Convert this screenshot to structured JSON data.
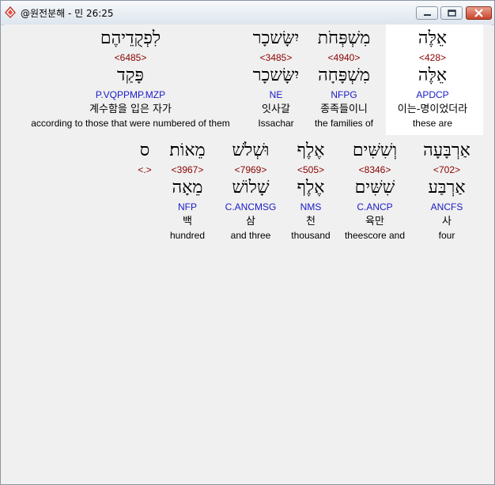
{
  "window": {
    "title": "@원전분해 - 민 26:25"
  },
  "colors": {
    "strong": "#8b0000",
    "parse": "#1a1ac8",
    "highlight": "#ffffff"
  },
  "icons": {
    "app": "bible-app-icon",
    "minimize": "minimize-icon",
    "maximize": "maximize-icon",
    "close": "close-icon"
  },
  "rows": [
    {
      "words": [
        {
          "hebrew": "אֵלֶּה",
          "strong": "<428>",
          "lemma": "אֵלֶּה",
          "parse": "APDCP",
          "korean": "이는-명이었더라",
          "english": "these are",
          "selected": true
        },
        {
          "hebrew": "מִשְׁפְּחֹת",
          "strong": "<4940>",
          "lemma": "מִשְׁפָּחָה",
          "parse": "NFPG",
          "korean": "종족들이니",
          "english": "the families of"
        },
        {
          "hebrew": "יִשָּׂשכָר",
          "strong": "<3485>",
          "lemma": "יִשָּׂשכָר",
          "parse": "NE",
          "korean": "잇사갈",
          "english": "Issachar"
        },
        {
          "hebrew": "לִפְקֻדֵיהֶם",
          "strong": "<6485>",
          "lemma": "פָּקַד",
          "parse": "P.VQPPMP.MZP",
          "korean": "계수함을 입은 자가",
          "english": "according to those that were numbered of them"
        }
      ]
    },
    {
      "words": [
        {
          "hebrew": "אַרְבָּעָה",
          "strong": "<702>",
          "lemma": "אַרְבַּע",
          "parse": "ANCFS",
          "korean": "사",
          "english": "four"
        },
        {
          "hebrew": "וְשִׁשִּׁים",
          "strong": "<8346>",
          "lemma": "שִׁשִּׁים",
          "parse": "C.ANCP",
          "korean": "육만",
          "english": "theescore and"
        },
        {
          "hebrew": "אֶלֶף",
          "strong": "<505>",
          "lemma": "אֶלֶף",
          "parse": "NMS",
          "korean": "천",
          "english": "thousand"
        },
        {
          "hebrew": "וּשְׁלֹשׁ",
          "strong": "<7969>",
          "lemma": "שָׁלוֹשׁ",
          "parse": "C.ANCMSG",
          "korean": "삼",
          "english": "and three"
        },
        {
          "hebrew": "מֵאוֹת׃",
          "strong": "<3967>",
          "lemma": "מֵאָה",
          "parse": "NFP",
          "korean": "백",
          "english": "hundred"
        },
        {
          "hebrew": "ס",
          "strong": "<.>",
          "lemma": "",
          "parse": "",
          "korean": "",
          "english": ""
        }
      ]
    }
  ]
}
